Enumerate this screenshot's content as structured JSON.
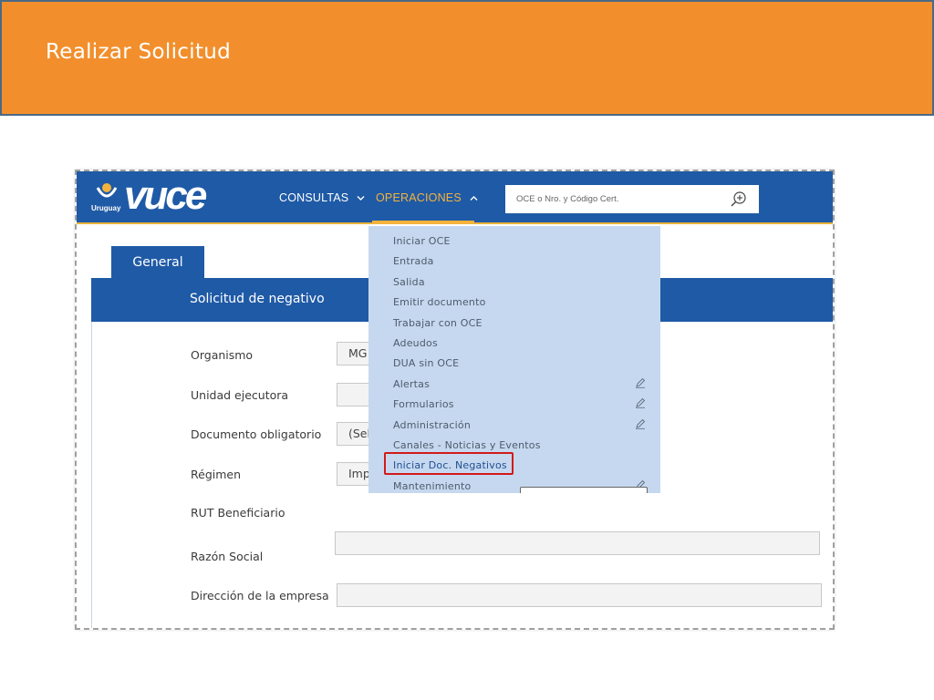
{
  "slide": {
    "title": "Realizar Solicitud"
  },
  "app": {
    "logo": {
      "country": "Uruguay",
      "wordmark": "vuce"
    },
    "nav": {
      "consultas": "CONSULTAS",
      "operaciones": "OPERACIONES"
    },
    "search": {
      "placeholder": "OCE o Nro. y Código Cert."
    },
    "tab": "General",
    "section_title": "Solicitud de negativo",
    "form": {
      "organismo": {
        "label": "Organismo",
        "value": "MG"
      },
      "unidad": {
        "label": "Unidad ejecutora",
        "value": ""
      },
      "documento": {
        "label": "Documento obligatorio",
        "value": "(Sel"
      },
      "regimen": {
        "label": "Régimen",
        "value": "Imp"
      },
      "rut": {
        "label": "RUT Beneficiario"
      },
      "razon": {
        "label": "Razón Social",
        "value": ""
      },
      "direccion": {
        "label": "Dirección de la empresa",
        "value": ""
      }
    },
    "menu": {
      "items": [
        "Iniciar OCE",
        "Entrada",
        "Salida",
        "Emitir documento",
        "Trabajar con OCE",
        "Adeudos",
        "DUA sin OCE",
        "Alertas",
        "Formularios",
        "Administración",
        "Canales - Noticias y Eventos",
        "Iniciar Doc. Negativos",
        "Mantenimiento"
      ]
    }
  },
  "colors": {
    "header_orange": "#f28f2c",
    "app_blue": "#1f5aa6",
    "accent_yellow": "#f3b33d",
    "menu_bg": "#c6d8ef",
    "highlight_red": "#d21a1a"
  }
}
